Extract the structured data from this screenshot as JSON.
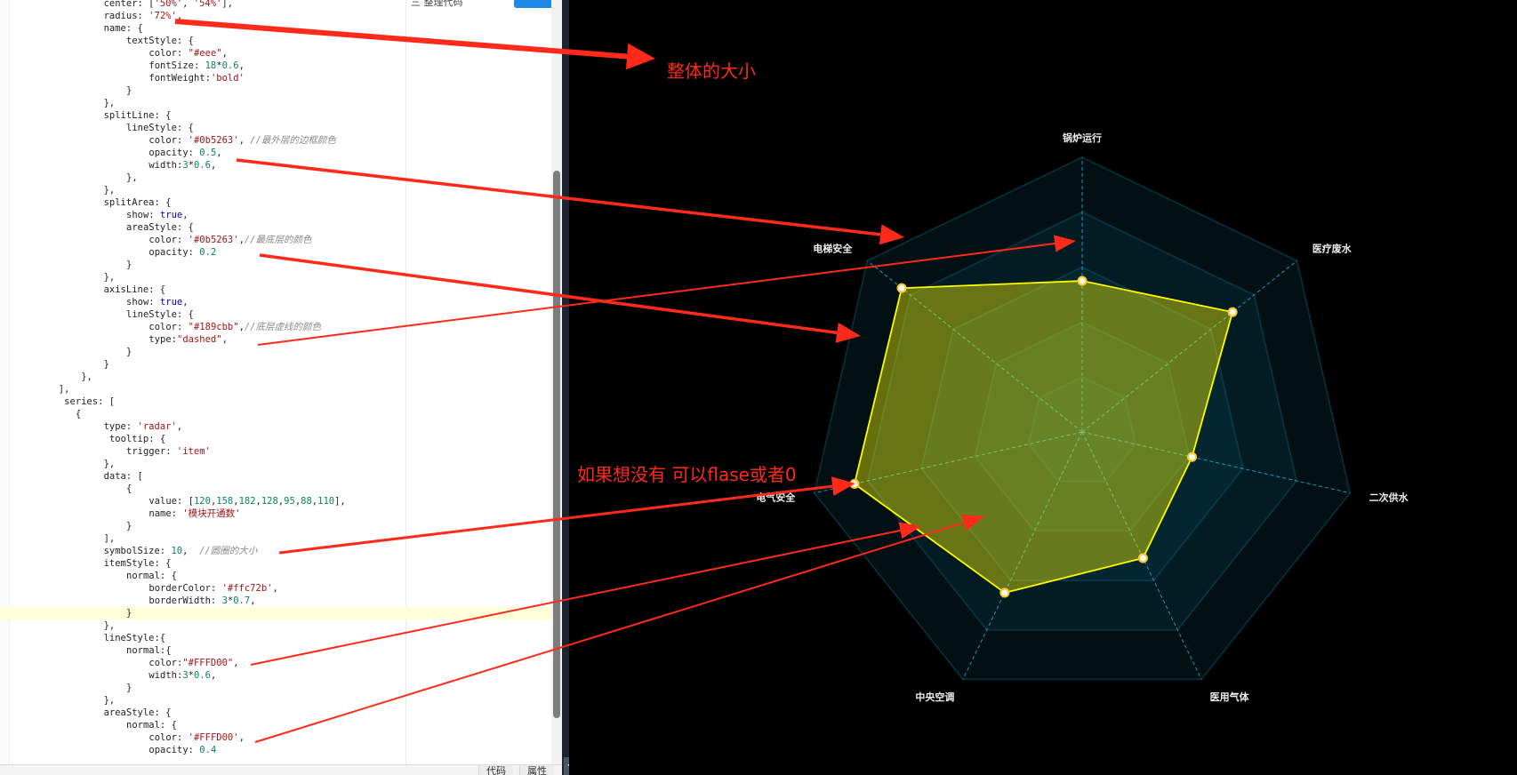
{
  "editor": {
    "code_lines": [
      {
        "indent": 16,
        "tokens": [
          [
            "p",
            "center: ["
          ],
          [
            "s",
            "'50%'"
          ],
          [
            "p",
            ", "
          ],
          [
            "s",
            "'54%'"
          ],
          [
            "p",
            "],"
          ]
        ]
      },
      {
        "indent": 16,
        "tokens": [
          [
            "p",
            "radius: "
          ],
          [
            "s",
            "'72%'"
          ],
          [
            "p",
            ","
          ]
        ]
      },
      {
        "indent": 16,
        "tokens": [
          [
            "p",
            "name: {"
          ]
        ]
      },
      {
        "indent": 20,
        "tokens": [
          [
            "p",
            "textStyle: {"
          ]
        ]
      },
      {
        "indent": 24,
        "tokens": [
          [
            "p",
            "color: "
          ],
          [
            "s",
            "\"#eee\""
          ],
          [
            "p",
            ","
          ]
        ]
      },
      {
        "indent": 24,
        "tokens": [
          [
            "p",
            "fontSize: "
          ],
          [
            "n",
            "18"
          ],
          [
            "p",
            "*"
          ],
          [
            "n",
            "0.6"
          ],
          [
            "p",
            ","
          ]
        ]
      },
      {
        "indent": 24,
        "tokens": [
          [
            "p",
            "fontWeight:"
          ],
          [
            "s",
            "'bold'"
          ]
        ]
      },
      {
        "indent": 20,
        "tokens": [
          [
            "p",
            "}"
          ]
        ]
      },
      {
        "indent": 16,
        "tokens": [
          [
            "p",
            "},"
          ]
        ]
      },
      {
        "indent": 16,
        "tokens": [
          [
            "p",
            "splitLine: {"
          ]
        ]
      },
      {
        "indent": 20,
        "tokens": [
          [
            "p",
            "lineStyle: {"
          ]
        ]
      },
      {
        "indent": 24,
        "tokens": [
          [
            "p",
            "color: "
          ],
          [
            "s",
            "'#0b5263'"
          ],
          [
            "p",
            ", "
          ],
          [
            "c",
            "//最外层的边框颜色"
          ]
        ]
      },
      {
        "indent": 24,
        "tokens": [
          [
            "p",
            "opacity: "
          ],
          [
            "n",
            "0.5"
          ],
          [
            "p",
            ","
          ]
        ]
      },
      {
        "indent": 24,
        "tokens": [
          [
            "p",
            "width:"
          ],
          [
            "n",
            "3"
          ],
          [
            "p",
            "*"
          ],
          [
            "n",
            "0.6"
          ],
          [
            "p",
            ","
          ]
        ]
      },
      {
        "indent": 20,
        "tokens": [
          [
            "p",
            "},"
          ]
        ]
      },
      {
        "indent": 16,
        "tokens": [
          [
            "p",
            "},"
          ]
        ]
      },
      {
        "indent": 16,
        "tokens": [
          [
            "p",
            "splitArea: {"
          ]
        ]
      },
      {
        "indent": 20,
        "tokens": [
          [
            "p",
            "show: "
          ],
          [
            "k",
            "true"
          ],
          [
            "p",
            ","
          ]
        ]
      },
      {
        "indent": 20,
        "tokens": [
          [
            "p",
            "areaStyle: {"
          ]
        ]
      },
      {
        "indent": 24,
        "tokens": [
          [
            "p",
            "color: "
          ],
          [
            "s",
            "'#0b5263'"
          ],
          [
            "p",
            ","
          ],
          [
            "c",
            "//最底层的颜色"
          ]
        ]
      },
      {
        "indent": 24,
        "tokens": [
          [
            "p",
            "opacity: "
          ],
          [
            "n",
            "0.2"
          ]
        ]
      },
      {
        "indent": 20,
        "tokens": [
          [
            "p",
            "}"
          ]
        ]
      },
      {
        "indent": 16,
        "tokens": [
          [
            "p",
            "},"
          ]
        ]
      },
      {
        "indent": 16,
        "tokens": [
          [
            "p",
            "axisLine: {"
          ]
        ]
      },
      {
        "indent": 20,
        "tokens": [
          [
            "p",
            "show: "
          ],
          [
            "k",
            "true"
          ],
          [
            "p",
            ","
          ]
        ]
      },
      {
        "indent": 20,
        "tokens": [
          [
            "p",
            "lineStyle: {"
          ]
        ]
      },
      {
        "indent": 24,
        "tokens": [
          [
            "p",
            "color: "
          ],
          [
            "s",
            "\"#189cbb\""
          ],
          [
            "p",
            ","
          ],
          [
            "c",
            "//底层虚线的颜色"
          ]
        ]
      },
      {
        "indent": 24,
        "tokens": [
          [
            "p",
            "type:"
          ],
          [
            "s",
            "\"dashed\""
          ],
          [
            "p",
            ","
          ]
        ]
      },
      {
        "indent": 20,
        "tokens": [
          [
            "p",
            "}"
          ]
        ]
      },
      {
        "indent": 16,
        "tokens": [
          [
            "p",
            "}"
          ]
        ]
      },
      {
        "indent": 12,
        "tokens": [
          [
            "p",
            "},"
          ]
        ]
      },
      {
        "indent": 8,
        "tokens": [
          [
            "p",
            "],"
          ]
        ]
      },
      {
        "indent": 9,
        "tokens": [
          [
            "p",
            "series: ["
          ]
        ]
      },
      {
        "indent": 11,
        "tokens": [
          [
            "p",
            "{"
          ]
        ]
      },
      {
        "indent": 16,
        "tokens": [
          [
            "p",
            "type: "
          ],
          [
            "s",
            "'radar'"
          ],
          [
            "p",
            ","
          ]
        ]
      },
      {
        "indent": 17,
        "tokens": [
          [
            "p",
            "tooltip: {"
          ]
        ]
      },
      {
        "indent": 20,
        "tokens": [
          [
            "p",
            "trigger: "
          ],
          [
            "s",
            "'item'"
          ]
        ]
      },
      {
        "indent": 16,
        "tokens": [
          [
            "p",
            "},"
          ]
        ]
      },
      {
        "indent": 16,
        "tokens": [
          [
            "p",
            "data: ["
          ]
        ]
      },
      {
        "indent": 20,
        "tokens": [
          [
            "p",
            "{"
          ]
        ]
      },
      {
        "indent": 24,
        "tokens": [
          [
            "p",
            "value: ["
          ],
          [
            "n",
            "120"
          ],
          [
            "p",
            ","
          ],
          [
            "n",
            "158"
          ],
          [
            "p",
            ","
          ],
          [
            "n",
            "182"
          ],
          [
            "p",
            ","
          ],
          [
            "n",
            "128"
          ],
          [
            "p",
            ","
          ],
          [
            "n",
            "95"
          ],
          [
            "p",
            ","
          ],
          [
            "n",
            "88"
          ],
          [
            "p",
            ","
          ],
          [
            "n",
            "110"
          ],
          [
            "p",
            "],"
          ]
        ]
      },
      {
        "indent": 24,
        "tokens": [
          [
            "p",
            "name: "
          ],
          [
            "s",
            "'模块开通数'"
          ]
        ]
      },
      {
        "indent": 20,
        "tokens": [
          [
            "p",
            "}"
          ]
        ]
      },
      {
        "indent": 16,
        "tokens": [
          [
            "p",
            "],"
          ]
        ]
      },
      {
        "indent": 16,
        "tokens": [
          [
            "p",
            "symbolSize: "
          ],
          [
            "n",
            "10"
          ],
          [
            "p",
            ",  "
          ],
          [
            "c",
            "//圆圈的大小"
          ]
        ]
      },
      {
        "indent": 16,
        "tokens": [
          [
            "p",
            "itemStyle: {"
          ]
        ]
      },
      {
        "indent": 20,
        "tokens": [
          [
            "p",
            "normal: {"
          ]
        ]
      },
      {
        "indent": 24,
        "tokens": [
          [
            "p",
            "borderColor: "
          ],
          [
            "s",
            "'#ffc72b'"
          ],
          [
            "p",
            ","
          ]
        ]
      },
      {
        "indent": 24,
        "tokens": [
          [
            "p",
            "borderWidth: "
          ],
          [
            "n",
            "3"
          ],
          [
            "p",
            "*"
          ],
          [
            "n",
            "0.7"
          ],
          [
            "p",
            ","
          ]
        ]
      },
      {
        "indent": 20,
        "tokens": [
          [
            "p",
            "}"
          ]
        ]
      },
      {
        "indent": 16,
        "tokens": [
          [
            "p",
            "},"
          ]
        ]
      },
      {
        "indent": 16,
        "tokens": [
          [
            "p",
            "lineStyle:{"
          ]
        ]
      },
      {
        "indent": 20,
        "tokens": [
          [
            "p",
            "normal:{"
          ]
        ]
      },
      {
        "indent": 24,
        "tokens": [
          [
            "p",
            "color:"
          ],
          [
            "s",
            "\"#FFFD00\""
          ],
          [
            "p",
            ","
          ]
        ]
      },
      {
        "indent": 24,
        "tokens": [
          [
            "p",
            "width:"
          ],
          [
            "n",
            "3"
          ],
          [
            "p",
            "*"
          ],
          [
            "n",
            "0.6"
          ],
          [
            "p",
            ","
          ]
        ]
      },
      {
        "indent": 20,
        "tokens": [
          [
            "p",
            "}"
          ]
        ]
      },
      {
        "indent": 16,
        "tokens": [
          [
            "p",
            "},"
          ]
        ]
      },
      {
        "indent": 16,
        "tokens": [
          [
            "p",
            "areaStyle: {"
          ]
        ]
      },
      {
        "indent": 20,
        "tokens": [
          [
            "p",
            "normal: {"
          ]
        ]
      },
      {
        "indent": 24,
        "tokens": [
          [
            "p",
            "color: "
          ],
          [
            "s",
            "'#FFFD00'"
          ],
          [
            "p",
            ","
          ]
        ]
      },
      {
        "indent": 24,
        "tokens": [
          [
            "p",
            "opacity: "
          ],
          [
            "n",
            "0.4"
          ]
        ]
      }
    ],
    "active_line_index": 49,
    "toolbar_text": "三  整理代码",
    "tabs": {
      "code": "代码",
      "props": "属性"
    },
    "collapse_glyph": "<"
  },
  "annotations": {
    "size_note": "整体的大小",
    "disable_note": "如果想没有 可以flase或者0"
  },
  "colors": {
    "annotation": "#ff2a1a",
    "series_line": "#FFFD00",
    "series_area": "#FFFD00",
    "symbol_border": "#ffc72b",
    "split_line": "#0b5263",
    "split_area": "#0b5263",
    "axis_line": "#189cbb",
    "indicator_name": "#eeeeee"
  },
  "chart_data": {
    "type": "radar",
    "indicators": [
      "锅炉运行",
      "医疗废水",
      "二次供水",
      "医用气体",
      "中央空调",
      "电气安全",
      "电梯安全"
    ],
    "series": [
      {
        "name": "模块开通数",
        "values": [
          120,
          158,
          182,
          128,
          95,
          88,
          110
        ]
      }
    ],
    "max_fraction": [
      0.55,
      0.7,
      0.41,
      0.51,
      0.65,
      0.85,
      0.84
    ],
    "split_number": 5,
    "axis_line_type": "dashed",
    "symbol_size": 10
  }
}
